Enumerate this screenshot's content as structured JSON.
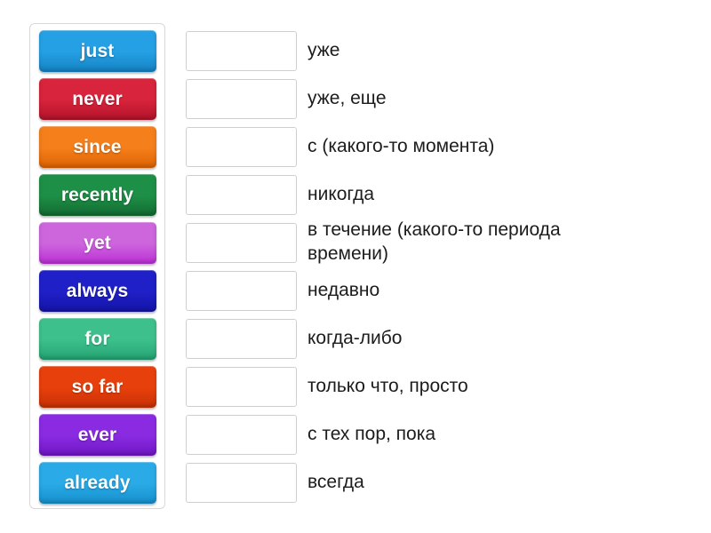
{
  "activity": {
    "type": "match-up-drag-and-drop",
    "tray": {
      "name": "word-tile-tray",
      "tiles": [
        {
          "label": "just",
          "color": "#25a0e4",
          "color_dark": "#1583c4"
        },
        {
          "label": "never",
          "color": "#d8243c",
          "color_dark": "#b3132a"
        },
        {
          "label": "since",
          "color": "#f57f1b",
          "color_dark": "#dd6302"
        },
        {
          "label": "recently",
          "color": "#1e8f46",
          "color_dark": "#136b32"
        },
        {
          "label": "yet",
          "color": "#cd65dd",
          "color_dark": "#bb2fd6"
        },
        {
          "label": "always",
          "color": "#2020c8",
          "color_dark": "#1414a8"
        },
        {
          "label": "for",
          "color": "#3ec08c",
          "color_dark": "#23a373"
        },
        {
          "label": "so far",
          "color": "#e8400c",
          "color_dark": "#c63105"
        },
        {
          "label": "ever",
          "color": "#8a2be2",
          "color_dark": "#6f16c4"
        },
        {
          "label": "already",
          "color": "#2aaae6",
          "color_dark": "#1590cd"
        }
      ]
    },
    "answers": {
      "name": "definition-list",
      "dropzone_placeholder": "",
      "rows": [
        {
          "dropzone_value": "",
          "definition": "уже"
        },
        {
          "dropzone_value": "",
          "definition": "уже, еще"
        },
        {
          "dropzone_value": "",
          "definition": "с (какого-то момента)"
        },
        {
          "dropzone_value": "",
          "definition": "никогда"
        },
        {
          "dropzone_value": "",
          "definition": "в течение (какого-то периода времени)"
        },
        {
          "dropzone_value": "",
          "definition": "недавно"
        },
        {
          "dropzone_value": "",
          "definition": "когда-либо"
        },
        {
          "dropzone_value": "",
          "definition": "только что, просто"
        },
        {
          "dropzone_value": "",
          "definition": "с тех пор, пока"
        },
        {
          "dropzone_value": "",
          "definition": "всегда"
        }
      ]
    }
  }
}
